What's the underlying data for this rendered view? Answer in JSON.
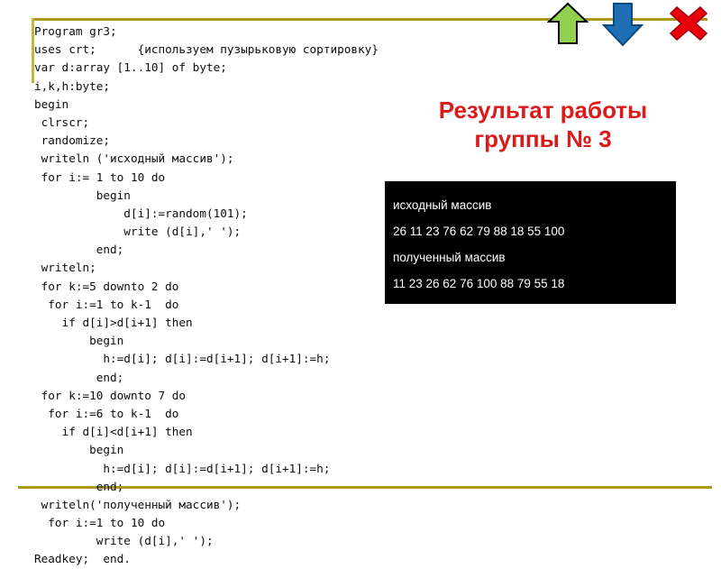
{
  "slide": {
    "title_lines": [
      "Результат работы",
      "группы № 3"
    ],
    "title_color": "#dd1a1a",
    "rule_color": "#a8991b"
  },
  "code": {
    "language": "Pascal",
    "lines": [
      "Program gr3;",
      "uses crt;      {используем пузырьковую сортировку}",
      "var d:array [1..10] of byte;",
      "i,k,h:byte;",
      "begin",
      " clrscr;",
      " randomize;",
      " writeln ('исходный массив');",
      " for i:= 1 to 10 do",
      "         begin",
      "             d[i]:=random(101);",
      "             write (d[i],' ');",
      "         end;",
      " writeln;",
      " for k:=5 downto 2 do",
      "  for i:=1 to k-1  do",
      "    if d[i]>d[i+1] then",
      "        begin",
      "          h:=d[i]; d[i]:=d[i+1]; d[i+1]:=h;",
      "         end;",
      " for k:=10 downto 7 do",
      "  for i:=6 to k-1  do",
      "    if d[i]<d[i+1] then",
      "        begin",
      "          h:=d[i]; d[i]:=d[i+1]; d[i+1]:=h;",
      "         end;",
      " writeln('полученный массив');",
      "  for i:=1 to 10 do",
      "         write (d[i],' ');",
      "Readkey;  end."
    ]
  },
  "console": {
    "background": "#000000",
    "text_color": "#ffffff",
    "lines": [
      "исходный массив",
      "26 11 23 76 62 79 88 18 55 100",
      "полученный массив",
      "11 23 26 62 76 100 88 79 55 18"
    ],
    "original_array": [
      26,
      11,
      23,
      76,
      62,
      79,
      88,
      18,
      55,
      100
    ],
    "result_array": [
      11,
      23,
      26,
      62,
      76,
      100,
      88,
      79,
      55,
      18
    ]
  },
  "icons": {
    "up_arrow": {
      "name": "up-arrow-icon",
      "fill": "#92d050",
      "stroke": "#000000"
    },
    "down_arrow": {
      "name": "down-arrow-icon",
      "fill": "#1f6fb5",
      "stroke": "#0b4a80"
    },
    "close": {
      "name": "close-icon",
      "fill": "#e8000d",
      "stroke": "#a50008"
    }
  }
}
